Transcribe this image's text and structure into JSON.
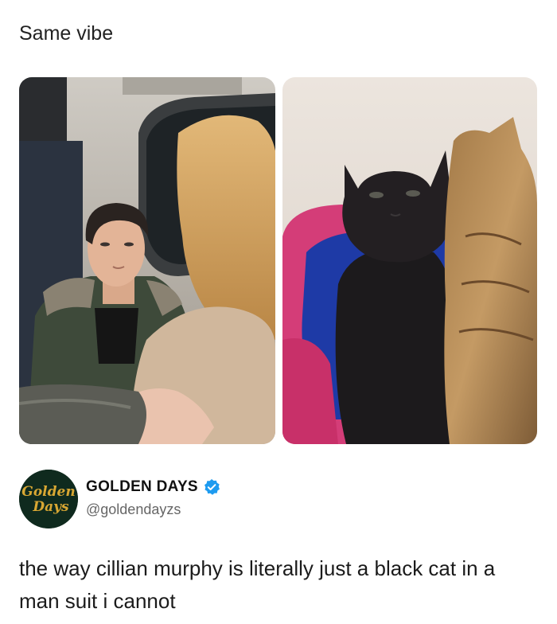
{
  "post": {
    "caption": "Same vibe"
  },
  "tweet": {
    "avatar_line1": "Golden",
    "avatar_line2": "Days",
    "display_name": "GOLDEN DAYS",
    "handle": "@goldendayzs",
    "text": "the way cillian murphy is literally just a black cat in a man suit i cannot",
    "verified_icon": "verified-badge-icon"
  },
  "colors": {
    "avatar_bg": "#0f2a1e",
    "avatar_text": "#d8a733",
    "verified_blue": "#1d9bf0",
    "handle_gray": "#666666"
  }
}
